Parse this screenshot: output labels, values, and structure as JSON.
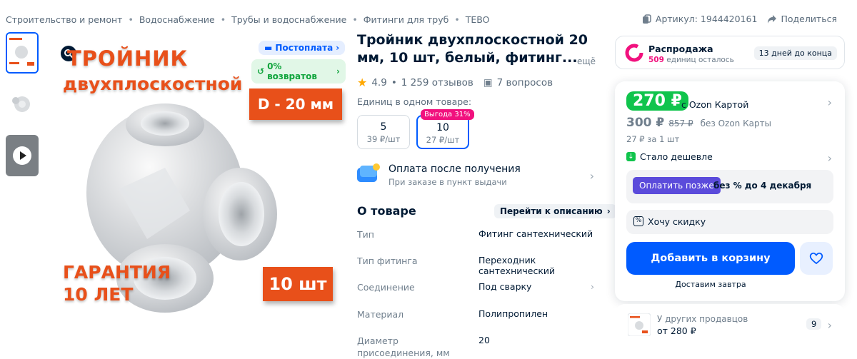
{
  "breadcrumbs": [
    "Строительство и ремонт",
    "Водоснабжение",
    "Трубы и водоснабжение",
    "Фитинги для труб",
    "TEBO"
  ],
  "article": "Артикул: 1944420161",
  "share": "Поделиться",
  "image": {
    "heading_line1": "ТРОЙНИК",
    "heading_line2": "двухплоскостной",
    "diameter_badge": "D - 20 мм",
    "guarantee_line1": "ГАРАНТИЯ",
    "guarantee_line2": "10 ЛЕТ",
    "count_badge": "10 шт",
    "postpay_badge": "Постоплата",
    "returns_badge": "0% возвратов"
  },
  "product": {
    "title": "Тройник двухплоскостной 20 мм, 10 шт, белый, фитинг...",
    "more": "ещё",
    "rating": "4.9",
    "reviews": "1 259 отзывов",
    "questions": "7 вопросов",
    "units_label": "Единиц в одном товаре:",
    "units": [
      {
        "count": "5",
        "price": "39 ₽/шт",
        "selected": false
      },
      {
        "count": "10",
        "price": "27 ₽/шт",
        "selected": true
      }
    ],
    "benefit_badge": "Выгода 31%",
    "payment_title": "Оплата после получения",
    "payment_sub": "При заказе в пункт выдачи",
    "about_title": "О товаре",
    "to_description": "Перейти к описанию",
    "specs": [
      {
        "key": "Тип",
        "value": "Фитинг сантехнический"
      },
      {
        "key": "Тип фитинга",
        "value": "Переходник сантехнический"
      },
      {
        "key": "Соединение",
        "value": "Под сварку"
      },
      {
        "key": "Материал",
        "value": "Полипропилен"
      },
      {
        "key": "Диаметр присоединения, мм",
        "value": "20"
      }
    ]
  },
  "sale": {
    "title": "Распродажа",
    "count": "509",
    "count_suffix": " единиц осталось",
    "days_left": "13 дней до конца"
  },
  "price": {
    "card_price": "270 ₽",
    "card_label": "с Ozon Картой",
    "price": "300 ₽",
    "old_price": "857 ₽",
    "no_card_label": "без Ozon Карты",
    "per_unit": "27 ₽ за 1 шт",
    "cheaper": "Стало дешевле",
    "pay_later_button": "Оплатить позже",
    "pay_later_text": "без % до 4 декабря",
    "want_discount": "Хочу скидку",
    "add_to_cart": "Добавить в корзину",
    "delivery": "Доставим завтра"
  },
  "other_sellers": {
    "title": "У других продавцов",
    "price": "от 280 ₽",
    "count": "9"
  },
  "colors": {
    "accent": "#005bff",
    "green": "#10c44c",
    "orange": "#e8501a",
    "pink": "#f1117e",
    "purple": "#5b4bdb"
  }
}
